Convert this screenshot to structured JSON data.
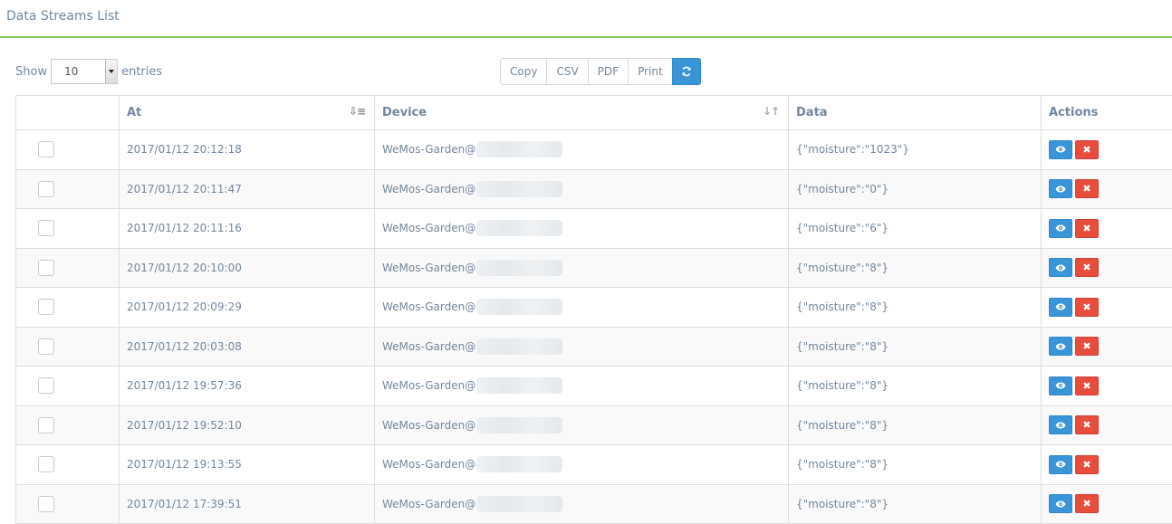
{
  "panel": {
    "title": "Data Streams List"
  },
  "length": {
    "show_label": "Show",
    "value": "10",
    "entries_label": "entries"
  },
  "buttons": {
    "copy": "Copy",
    "csv": "CSV",
    "pdf": "PDF",
    "print": "Print",
    "refresh_icon": "refresh-icon"
  },
  "table": {
    "headers": {
      "at": "At",
      "device": "Device",
      "data": "Data",
      "actions": "Actions"
    },
    "rows": [
      {
        "at": "2017/01/12 20:12:18",
        "device": "WeMos-Garden@",
        "data": "{\"moisture\":\"1023\"}"
      },
      {
        "at": "2017/01/12 20:11:47",
        "device": "WeMos-Garden@",
        "data": "{\"moisture\":\"0\"}"
      },
      {
        "at": "2017/01/12 20:11:16",
        "device": "WeMos-Garden@",
        "data": "{\"moisture\":\"6\"}"
      },
      {
        "at": "2017/01/12 20:10:00",
        "device": "WeMos-Garden@",
        "data": "{\"moisture\":\"8\"}"
      },
      {
        "at": "2017/01/12 20:09:29",
        "device": "WeMos-Garden@",
        "data": "{\"moisture\":\"8\"}"
      },
      {
        "at": "2017/01/12 20:03:08",
        "device": "WeMos-Garden@",
        "data": "{\"moisture\":\"8\"}"
      },
      {
        "at": "2017/01/12 19:57:36",
        "device": "WeMos-Garden@",
        "data": "{\"moisture\":\"8\"}"
      },
      {
        "at": "2017/01/12 19:52:10",
        "device": "WeMos-Garden@",
        "data": "{\"moisture\":\"8\"}"
      },
      {
        "at": "2017/01/12 19:13:55",
        "device": "WeMos-Garden@",
        "data": "{\"moisture\":\"8\"}"
      },
      {
        "at": "2017/01/12 17:39:51",
        "device": "WeMos-Garden@",
        "data": "{\"moisture\":\"8\"}"
      }
    ],
    "action_icons": {
      "view": "eye-icon",
      "delete": "close-icon"
    }
  },
  "colors": {
    "accent_green": "#7ed05e",
    "primary_blue": "#3a95d8",
    "danger_red": "#e74c3c"
  }
}
